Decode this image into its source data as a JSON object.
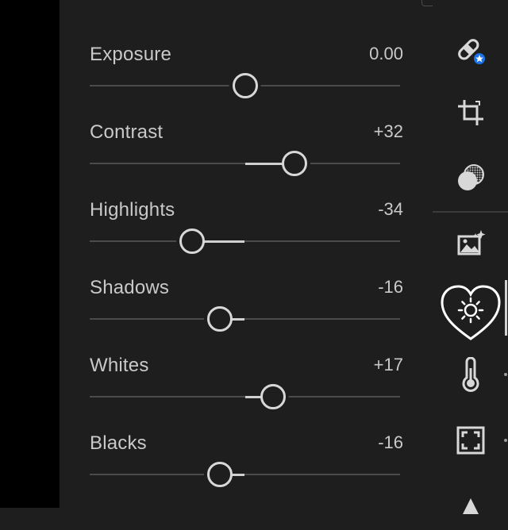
{
  "sliders": [
    {
      "label": "Exposure",
      "value": "0.00",
      "level": 0.5,
      "fill_from": null
    },
    {
      "label": "Contrast",
      "value": "+32",
      "level": 0.66,
      "fill_from": 0.5
    },
    {
      "label": "Highlights",
      "value": "-34",
      "level": 0.33,
      "fill_from": 0.5
    },
    {
      "label": "Shadows",
      "value": "-16",
      "level": 0.42,
      "fill_from": 0.5
    },
    {
      "label": "Whites",
      "value": "+17",
      "level": 0.59,
      "fill_from": 0.5
    },
    {
      "label": "Blacks",
      "value": "-16",
      "level": 0.42,
      "fill_from": 0.5
    }
  ],
  "toolbar": {
    "icons": [
      "healing-icon",
      "crop-icon",
      "masking-icon",
      "presets-icon",
      "light-icon",
      "color-temperature-icon",
      "vignette-icon",
      "detail-icon"
    ],
    "active": "light-icon"
  },
  "colors": {
    "background": "#1e1e1e",
    "text": "#c9c9c9",
    "track": "#4b4b4b",
    "accent_badge": "#1a73e8"
  }
}
